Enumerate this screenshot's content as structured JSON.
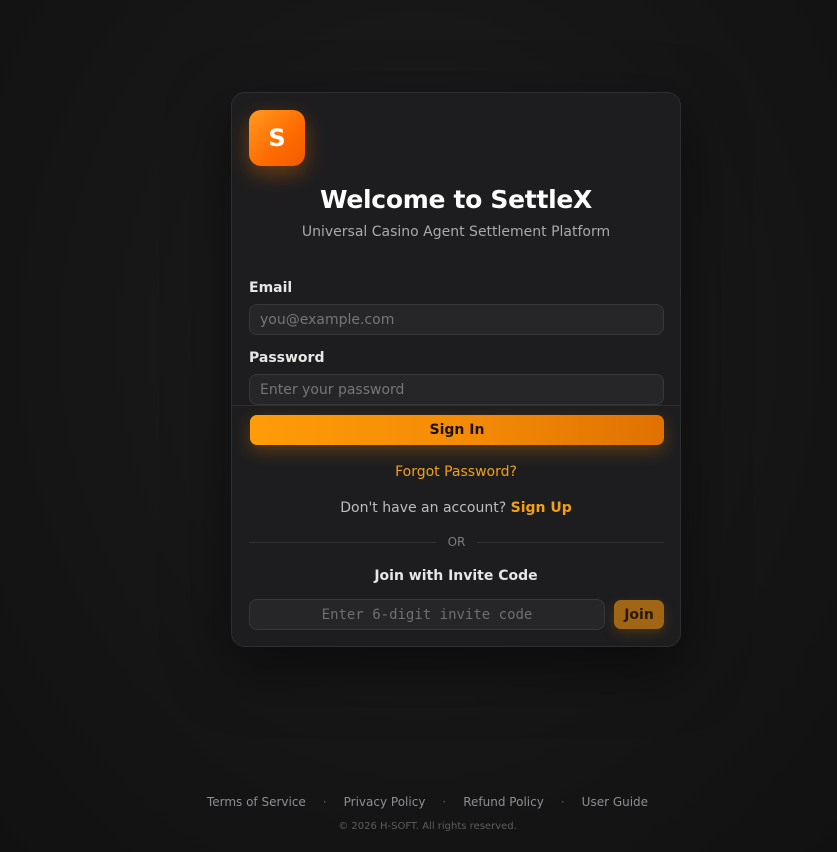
{
  "brand": {
    "logo_letter": "S",
    "accent_color": "#ff8a00"
  },
  "header": {
    "title": "Welcome to SettleX",
    "subtitle": "Universal Casino Agent Settlement Platform"
  },
  "form": {
    "email_label": "Email",
    "email_value": "",
    "email_placeholder": "you@example.com",
    "password_label": "Password",
    "password_value": "",
    "password_placeholder": "Enter your password",
    "signin_label": "Sign In",
    "forgot_label": "Forgot Password?",
    "no_account_text": "Don't have an account? ",
    "signup_label": "Sign Up"
  },
  "divider": {
    "or_text": "OR"
  },
  "invite": {
    "title": "Join with Invite Code",
    "code_value": "",
    "code_placeholder": "Enter 6-digit invite code",
    "join_label": "Join"
  },
  "footer": {
    "links": [
      "Terms of Service",
      "Privacy Policy",
      "Refund Policy",
      "User Guide"
    ],
    "separator": "·",
    "copyright": "© 2026 H-SOFT. All rights reserved."
  }
}
